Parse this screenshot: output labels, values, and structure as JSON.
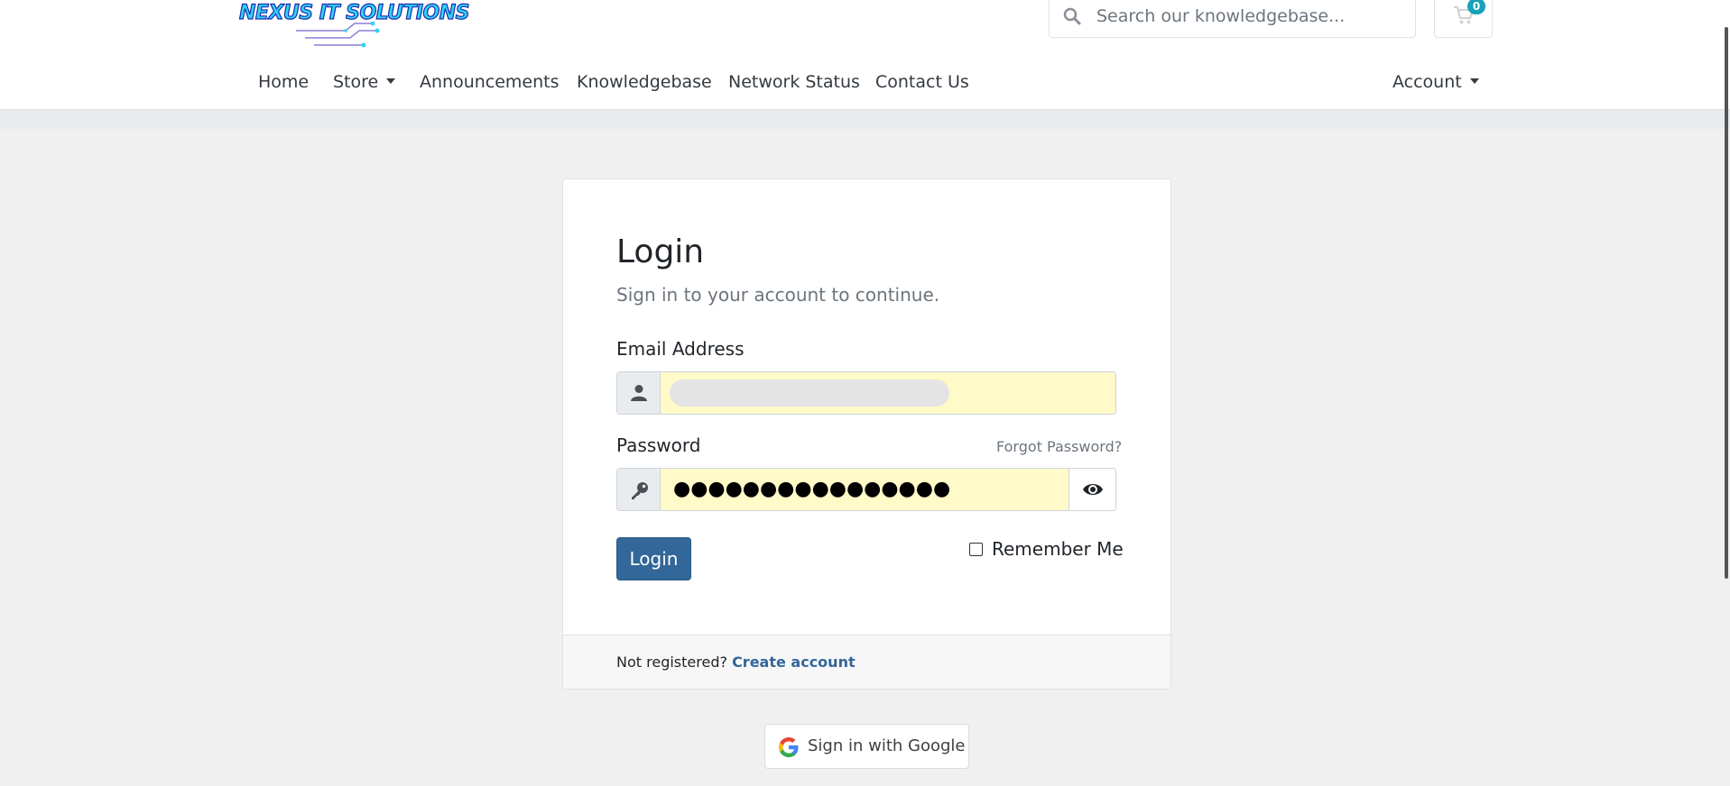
{
  "header": {
    "logo_text": "NEXUS IT SOLUTIONS",
    "search": {
      "placeholder": "Search our knowledgebase..."
    },
    "cart": {
      "count": "0"
    }
  },
  "nav": {
    "home": "Home",
    "store": "Store",
    "announcements": "Announcements",
    "knowledgebase": "Knowledgebase",
    "network_status": "Network Status",
    "contact_us": "Contact Us",
    "account": "Account"
  },
  "login": {
    "title": "Login",
    "subtitle": "Sign in to your account to continue.",
    "email_label": "Email Address",
    "email_value": "",
    "password_label": "Password",
    "password_value": "●●●●●●●●●●●●●●●●",
    "forgot_password": "Forgot Password?",
    "login_button": "Login",
    "remember_me": "Remember Me",
    "not_registered": "Not registered?",
    "create_account": "Create account"
  },
  "google": {
    "label": "Sign in with Google"
  },
  "colors": {
    "primary": "#336699",
    "autofill": "#fffac8",
    "badge": "#17a2b8",
    "background": "#f0f0f0"
  }
}
